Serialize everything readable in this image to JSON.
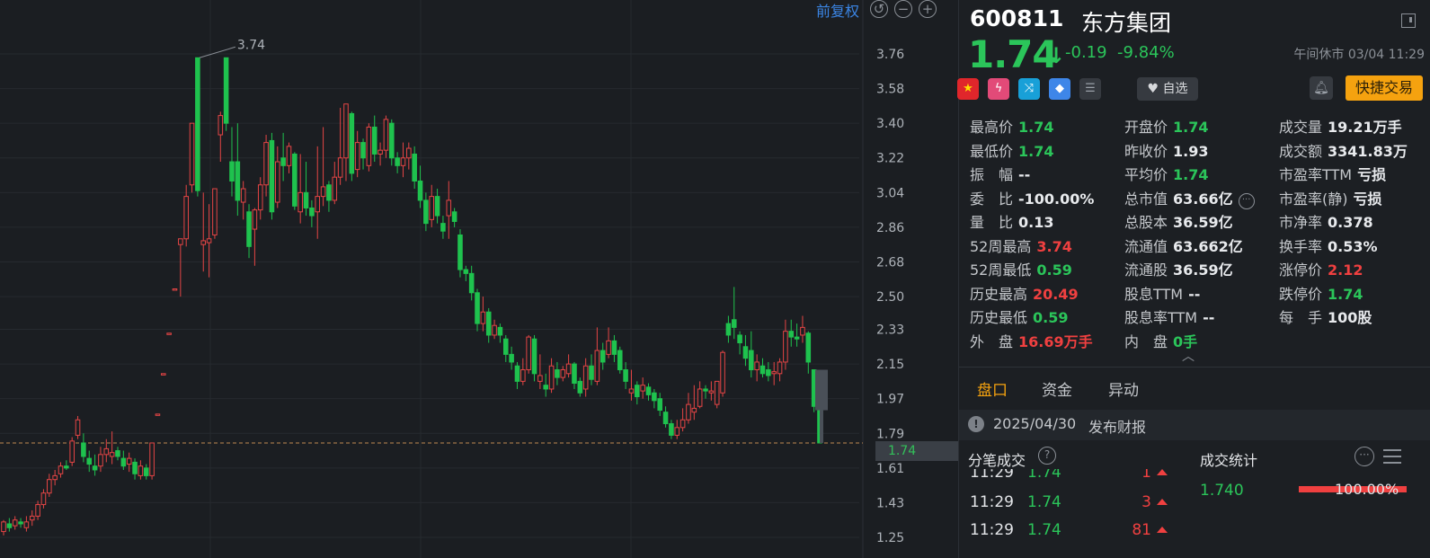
{
  "chart": {
    "adjust_label": "前复权",
    "y_ticks": [
      "3.76",
      "3.58",
      "3.40",
      "3.22",
      "3.04",
      "2.86",
      "2.68",
      "2.50",
      "2.33",
      "2.15",
      "1.97",
      "1.79",
      "1.61",
      "1.43",
      "1.25"
    ],
    "y_min": 1.25,
    "y_max": 3.76,
    "high_label": "3.74",
    "current_price": "1.74",
    "up_color": "#e54545",
    "down_color": "#1fc24e",
    "candles": [
      [
        1.28,
        1.33,
        1.26,
        1.34
      ],
      [
        1.32,
        1.3,
        1.28,
        1.35
      ],
      [
        1.31,
        1.34,
        1.29,
        1.36
      ],
      [
        1.33,
        1.32,
        1.3,
        1.35
      ],
      [
        1.3,
        1.33,
        1.28,
        1.36
      ],
      [
        1.34,
        1.36,
        1.31,
        1.39
      ],
      [
        1.36,
        1.42,
        1.34,
        1.44
      ],
      [
        1.42,
        1.48,
        1.4,
        1.5
      ],
      [
        1.48,
        1.55,
        1.46,
        1.58
      ],
      [
        1.55,
        1.57,
        1.52,
        1.6
      ],
      [
        1.58,
        1.62,
        1.56,
        1.64
      ],
      [
        1.62,
        1.61,
        1.6,
        1.65
      ],
      [
        1.64,
        1.75,
        1.62,
        1.77
      ],
      [
        1.78,
        1.86,
        1.76,
        1.88
      ],
      [
        1.74,
        1.67,
        1.64,
        1.79
      ],
      [
        1.66,
        1.63,
        1.59,
        1.7
      ],
      [
        1.62,
        1.6,
        1.57,
        1.68
      ],
      [
        1.62,
        1.68,
        1.59,
        1.72
      ],
      [
        1.68,
        1.71,
        1.64,
        1.76
      ],
      [
        1.67,
        1.69,
        1.63,
        1.8
      ],
      [
        1.7,
        1.67,
        1.65,
        1.72
      ],
      [
        1.66,
        1.62,
        1.6,
        1.7
      ],
      [
        1.63,
        1.66,
        1.59,
        1.69
      ],
      [
        1.64,
        1.58,
        1.55,
        1.66
      ],
      [
        1.57,
        1.62,
        1.55,
        1.65
      ],
      [
        1.61,
        1.57,
        1.55,
        1.63
      ],
      [
        1.57,
        1.74,
        1.55,
        1.74
      ],
      [
        1.89,
        1.89,
        1.89,
        1.89
      ],
      [
        2.1,
        2.1,
        2.1,
        2.1
      ],
      [
        2.31,
        2.31,
        2.31,
        2.31
      ],
      [
        2.54,
        2.54,
        2.54,
        2.54
      ],
      [
        2.77,
        2.8,
        2.5,
        2.8
      ],
      [
        2.8,
        3.02,
        2.76,
        3.08
      ],
      [
        3.08,
        3.4,
        3.04,
        3.4
      ],
      [
        3.74,
        3.05,
        3.02,
        3.74
      ],
      [
        2.77,
        2.79,
        2.63,
        3.04
      ],
      [
        2.78,
        2.8,
        2.6,
        2.98
      ],
      [
        2.82,
        3.06,
        2.8,
        3.06
      ],
      [
        3.34,
        3.44,
        3.2,
        3.46
      ],
      [
        3.74,
        3.4,
        3.36,
        3.74
      ],
      [
        3.2,
        3.1,
        3.02,
        3.38
      ],
      [
        3.2,
        3.0,
        2.92,
        3.4
      ],
      [
        2.99,
        3.06,
        2.9,
        3.1
      ],
      [
        2.94,
        2.76,
        2.7,
        2.98
      ],
      [
        2.85,
        2.95,
        2.66,
        2.96
      ],
      [
        2.95,
        3.08,
        2.9,
        3.12
      ],
      [
        3.08,
        3.3,
        3.02,
        3.34
      ],
      [
        3.31,
        2.94,
        2.9,
        3.35
      ],
      [
        2.99,
        3.2,
        2.96,
        3.28
      ],
      [
        3.22,
        3.18,
        3.1,
        3.35
      ],
      [
        3.18,
        3.28,
        3.14,
        3.3
      ],
      [
        3.24,
        2.97,
        2.95,
        3.25
      ],
      [
        2.94,
        3.04,
        2.88,
        3.24
      ],
      [
        3.04,
        2.96,
        2.92,
        3.2
      ],
      [
        2.96,
        2.92,
        2.86,
        3.0
      ],
      [
        2.94,
        3.02,
        2.8,
        3.28
      ],
      [
        3.02,
        3.07,
        2.97,
        3.38
      ],
      [
        3.08,
        3.0,
        2.94,
        3.1
      ],
      [
        3.0,
        3.12,
        2.98,
        3.2
      ],
      [
        3.12,
        3.22,
        3.08,
        3.48
      ],
      [
        3.22,
        3.5,
        3.1,
        3.5
      ],
      [
        3.45,
        3.14,
        3.1,
        3.46
      ],
      [
        3.16,
        3.3,
        3.12,
        3.36
      ],
      [
        3.3,
        3.22,
        3.16,
        3.32
      ],
      [
        3.18,
        3.38,
        3.15,
        3.4
      ],
      [
        3.38,
        3.24,
        3.2,
        3.44
      ],
      [
        3.24,
        3.26,
        3.18,
        3.3
      ],
      [
        3.26,
        3.42,
        3.22,
        3.44
      ],
      [
        3.4,
        3.22,
        3.18,
        3.42
      ],
      [
        3.22,
        3.18,
        3.14,
        3.25
      ],
      [
        3.18,
        3.22,
        3.12,
        3.3
      ],
      [
        3.22,
        3.27,
        3.16,
        3.3
      ],
      [
        3.24,
        3.1,
        3.06,
        3.28
      ],
      [
        3.1,
        3.0,
        2.96,
        3.18
      ],
      [
        3.0,
        2.88,
        2.84,
        3.04
      ],
      [
        2.9,
        3.02,
        2.86,
        3.08
      ],
      [
        3.02,
        2.92,
        2.88,
        3.06
      ],
      [
        2.88,
        2.84,
        2.8,
        2.92
      ],
      [
        2.92,
        3.0,
        2.8,
        3.1
      ],
      [
        2.94,
        2.89,
        2.86,
        2.96
      ],
      [
        2.82,
        2.64,
        2.6,
        2.85
      ],
      [
        2.64,
        2.62,
        2.58,
        2.66
      ],
      [
        2.62,
        2.52,
        2.48,
        2.66
      ],
      [
        2.52,
        2.36,
        2.32,
        2.54
      ],
      [
        2.36,
        2.42,
        2.32,
        2.5
      ],
      [
        2.42,
        2.3,
        2.26,
        2.44
      ],
      [
        2.3,
        2.35,
        2.28,
        2.38
      ],
      [
        2.34,
        2.3,
        2.26,
        2.36
      ],
      [
        2.28,
        2.2,
        2.16,
        2.3
      ],
      [
        2.2,
        2.16,
        2.12,
        2.24
      ],
      [
        2.14,
        2.06,
        2.02,
        2.16
      ],
      [
        2.06,
        2.12,
        2.04,
        2.18
      ],
      [
        2.12,
        2.29,
        2.1,
        2.3
      ],
      [
        2.28,
        2.1,
        2.06,
        2.3
      ],
      [
        2.06,
        2.09,
        2.02,
        2.2
      ],
      [
        2.04,
        2.02,
        1.98,
        2.1
      ],
      [
        2.02,
        2.14,
        2.0,
        2.18
      ],
      [
        2.12,
        2.08,
        2.04,
        2.16
      ],
      [
        2.08,
        2.12,
        2.06,
        2.14
      ],
      [
        2.1,
        2.15,
        2.08,
        2.2
      ],
      [
        2.15,
        2.05,
        2.02,
        2.16
      ],
      [
        2.06,
        2.0,
        1.98,
        2.08
      ],
      [
        2.02,
        2.14,
        1.98,
        2.18
      ],
      [
        2.14,
        2.07,
        2.04,
        2.2
      ],
      [
        2.06,
        2.22,
        2.04,
        2.34
      ],
      [
        2.22,
        2.16,
        2.12,
        2.26
      ],
      [
        2.2,
        2.27,
        2.18,
        2.34
      ],
      [
        2.27,
        2.2,
        2.16,
        2.3
      ],
      [
        2.22,
        2.12,
        2.1,
        2.24
      ],
      [
        2.12,
        2.06,
        2.02,
        2.16
      ],
      [
        2.0,
        2.02,
        1.96,
        2.12
      ],
      [
        2.04,
        1.98,
        1.94,
        2.06
      ],
      [
        2.01,
        2.04,
        1.97,
        2.08
      ],
      [
        2.03,
        1.99,
        1.96,
        2.05
      ],
      [
        2.0,
        1.96,
        1.92,
        2.02
      ],
      [
        1.97,
        1.91,
        1.88,
        2.0
      ],
      [
        1.9,
        1.84,
        1.82,
        1.93
      ],
      [
        1.84,
        1.78,
        1.76,
        1.86
      ],
      [
        1.78,
        1.82,
        1.76,
        1.86
      ],
      [
        1.82,
        1.86,
        1.8,
        1.92
      ],
      [
        1.86,
        1.94,
        1.84,
        2.0
      ],
      [
        1.9,
        1.92,
        1.86,
        2.04
      ],
      [
        1.93,
        2.02,
        1.92,
        2.06
      ],
      [
        2.02,
        2.01,
        1.97,
        2.04
      ],
      [
        2.0,
        2.01,
        1.96,
        2.06
      ],
      [
        1.94,
        2.06,
        1.92,
        2.06
      ],
      [
        2.0,
        2.21,
        1.98,
        2.22
      ],
      [
        2.36,
        2.3,
        2.26,
        2.4
      ],
      [
        2.38,
        2.34,
        2.28,
        2.55
      ],
      [
        2.3,
        2.26,
        2.2,
        2.32
      ],
      [
        2.24,
        2.18,
        2.14,
        2.3
      ],
      [
        2.22,
        2.12,
        2.08,
        2.32
      ],
      [
        2.12,
        2.16,
        2.06,
        2.2
      ],
      [
        2.14,
        2.1,
        2.08,
        2.18
      ],
      [
        2.12,
        2.09,
        2.06,
        2.16
      ],
      [
        2.1,
        2.11,
        2.04,
        2.16
      ],
      [
        2.1,
        2.16,
        2.06,
        2.18
      ],
      [
        2.16,
        2.32,
        2.12,
        2.38
      ],
      [
        2.32,
        2.29,
        2.24,
        2.38
      ],
      [
        2.29,
        2.28,
        2.24,
        2.36
      ],
      [
        2.3,
        2.34,
        2.26,
        2.4
      ],
      [
        2.31,
        2.16,
        2.1,
        2.32
      ],
      [
        2.12,
        1.93,
        1.9,
        2.12
      ],
      [
        1.91,
        1.74,
        1.74,
        1.91
      ]
    ]
  },
  "header": {
    "code": "600811",
    "name": "东方集团",
    "price": "1.74",
    "change": "-0.19",
    "change_pct": "-9.84%",
    "status": "午间休市 03/04 11:29"
  },
  "toolbar": {
    "favorite_label": "自选",
    "trade_label": "快捷交易"
  },
  "quote": {
    "col1": [
      {
        "label": "最高价",
        "value": "1.74",
        "color": "g"
      },
      {
        "label": "最低价",
        "value": "1.74",
        "color": "g"
      },
      {
        "label": "振　幅",
        "value": "--",
        "color": "w"
      },
      {
        "label": "委　比",
        "value": "-100.00%",
        "color": "w"
      },
      {
        "label": "量　比",
        "value": "0.13",
        "color": "w"
      },
      {
        "label": "52周最高",
        "value": "3.74",
        "color": "r"
      },
      {
        "label": "52周最低",
        "value": "0.59",
        "color": "g"
      },
      {
        "label": "历史最高",
        "value": "20.49",
        "color": "r"
      },
      {
        "label": "历史最低",
        "value": "0.59",
        "color": "g"
      },
      {
        "label": "外　盘",
        "value": "16.69万手",
        "color": "r"
      }
    ],
    "col2": [
      {
        "label": "开盘价",
        "value": "1.74",
        "color": "g"
      },
      {
        "label": "昨收价",
        "value": "1.93",
        "color": "w"
      },
      {
        "label": "平均价",
        "value": "1.74",
        "color": "g"
      },
      {
        "label": "总市值",
        "value": "63.66亿",
        "color": "w"
      },
      {
        "label": "总股本",
        "value": "36.59亿",
        "color": "w"
      },
      {
        "label": "流通值",
        "value": "63.662亿",
        "color": "w"
      },
      {
        "label": "流通股",
        "value": "36.59亿",
        "color": "w"
      },
      {
        "label": "股息TTM",
        "value": "--",
        "color": "w"
      },
      {
        "label": "股息率TTM",
        "value": "--",
        "color": "w"
      },
      {
        "label": "内　盘",
        "value": "0手",
        "color": "g"
      }
    ],
    "col3": [
      {
        "label": "成交量",
        "value": "19.21万手",
        "color": "w"
      },
      {
        "label": "成交额",
        "value": "3341.83万",
        "color": "w"
      },
      {
        "label": "市盈率TTM",
        "value": "亏损",
        "color": "w"
      },
      {
        "label": "市盈率(静)",
        "value": "亏损",
        "color": "w"
      },
      {
        "label": "市净率",
        "value": "0.378",
        "color": "w"
      },
      {
        "label": "换手率",
        "value": "0.53%",
        "color": "w"
      },
      {
        "label": "涨停价",
        "value": "2.12",
        "color": "r"
      },
      {
        "label": "跌停价",
        "value": "1.74",
        "color": "g"
      },
      {
        "label": "每　手",
        "value": "100股",
        "color": "w"
      }
    ]
  },
  "tabs": [
    "盘口",
    "资金",
    "异动"
  ],
  "report": {
    "date": "2025/04/30",
    "text": "发布财报"
  },
  "trades_section": {
    "title": "分笔成交",
    "rows": [
      {
        "time": "11:29",
        "price": "1.74",
        "vol": "1"
      },
      {
        "time": "11:29",
        "price": "1.74",
        "vol": "3"
      },
      {
        "time": "11:29",
        "price": "1.74",
        "vol": "81"
      }
    ]
  },
  "stats_section": {
    "title": "成交统计",
    "price": "1.740",
    "pct": "100.00%"
  }
}
